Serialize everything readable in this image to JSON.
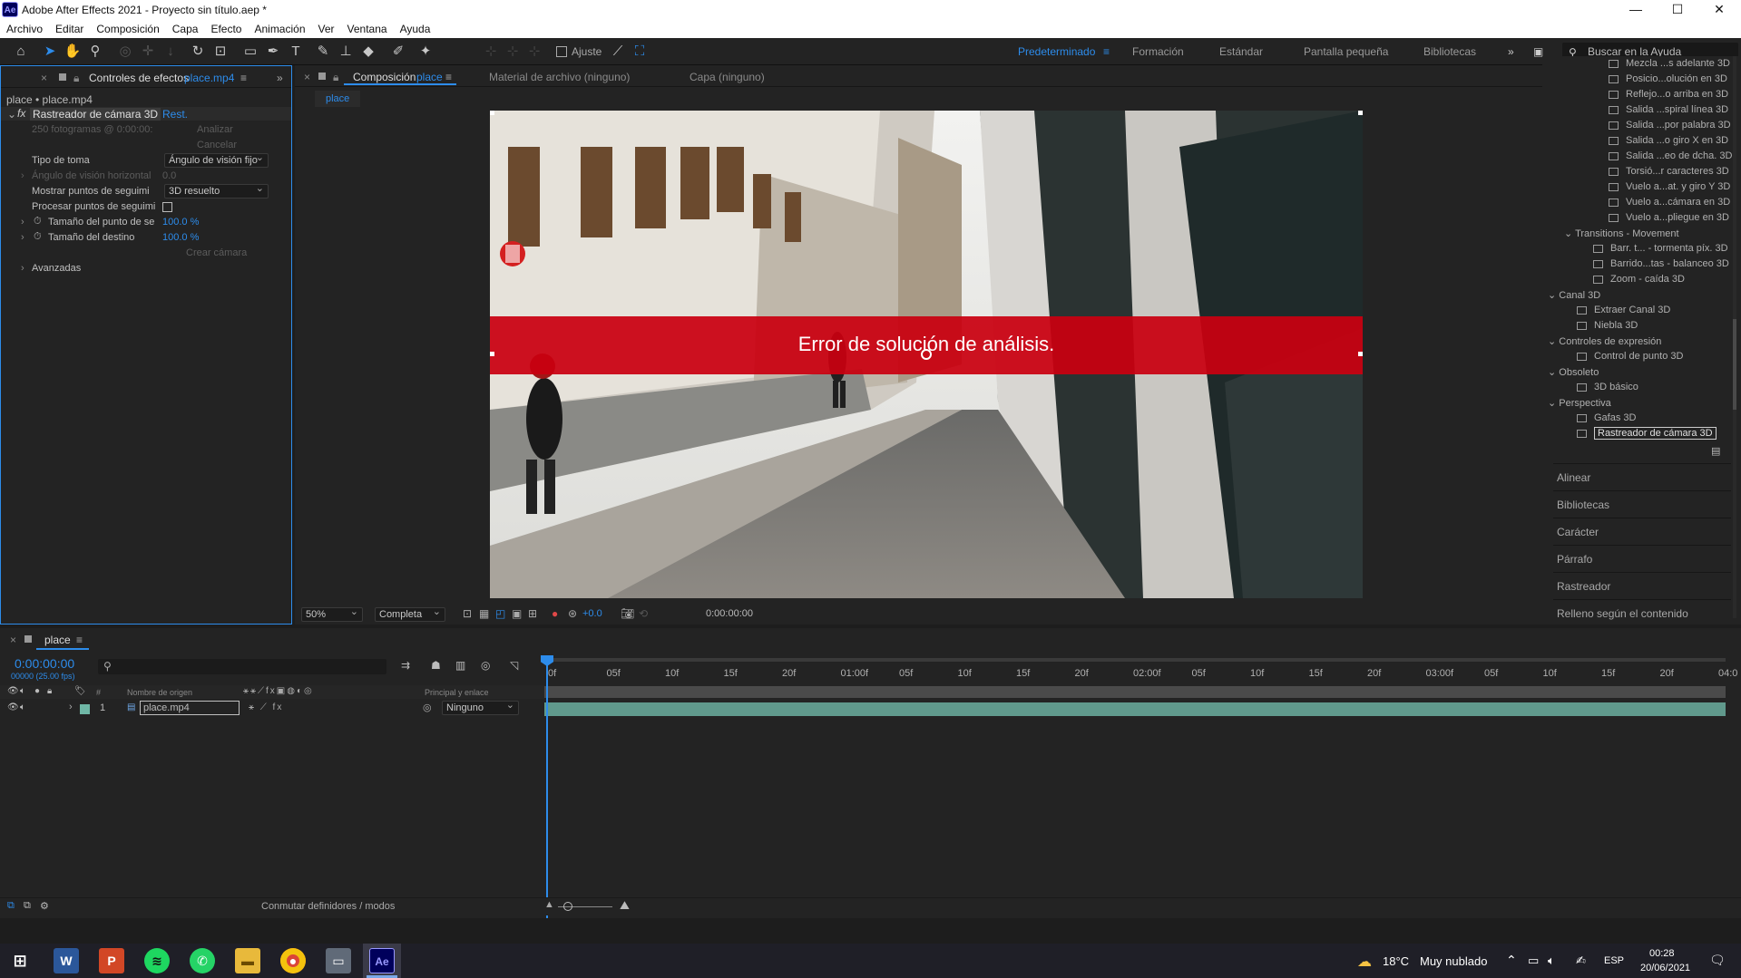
{
  "window": {
    "title": "Adobe After Effects 2021 - Proyecto sin título.aep *",
    "logo": "Ae",
    "min": "—",
    "max": "☐",
    "close": "✕"
  },
  "menu": [
    "Archivo",
    "Editar",
    "Composición",
    "Capa",
    "Efecto",
    "Animación",
    "Ver",
    "Ventana",
    "Ayuda"
  ],
  "toolbar": {
    "snap_label": "Ajuste",
    "workspaces": [
      "Predeterminado",
      "Formación",
      "Estándar",
      "Pantalla pequeña",
      "Bibliotecas"
    ],
    "active_workspace": "Predeterminado",
    "search_placeholder": "Buscar en la Ayuda"
  },
  "effects_panel": {
    "tab_label": "Controles de efectos",
    "tab_file": "place.mp4",
    "breadcrumb": "place • place.mp4",
    "effect_name": "Rastreador de cámara 3D",
    "reset": "Rest.",
    "frames_info": "250 fotogramas @ 0:00:00:",
    "analyze": "Analizar",
    "cancel": "Cancelar",
    "shot_type_label": "Tipo de toma",
    "shot_type_value": "Ángulo de visión fijo",
    "hfov_label": "Ángulo de visión horizontal",
    "hfov_value": "0.0",
    "show_points_label": "Mostrar puntos de seguimi",
    "show_points_value": "3D resuelto",
    "render_points_label": "Procesar puntos de seguimi",
    "point_size_label": "Tamaño del punto de se",
    "point_size_value": "100.0 %",
    "target_size_label": "Tamaño del destino",
    "target_size_value": "100.0 %",
    "create_camera": "Crear cámara",
    "advanced": "Avanzadas"
  },
  "comp_panel": {
    "tab_label": "Composición",
    "tab_comp": "place",
    "footage_tab": "Material de archivo (ninguno)",
    "layer_tab": "Capa (ninguno)",
    "subtab": "place",
    "error_text": "Error de solución de análisis.",
    "zoom": "50%",
    "resolution": "Completa",
    "exposure": "+0.0",
    "timecode": "0:00:00:00"
  },
  "effects_list": {
    "items_top": [
      "Mezcla ...s adelante 3D",
      "Posicio...olución en 3D",
      "Reflejo...o arriba en 3D",
      "Salida ...spiral línea 3D",
      "Salida ...por palabra 3D",
      "Salida ...o giro X en 3D",
      "Salida ...eo de dcha. 3D",
      "Torsió...r caracteres 3D",
      "Vuelo a...at. y giro Y 3D",
      "Vuelo a...cámara en 3D",
      "Vuelo a...pliegue en 3D"
    ],
    "transitions_group": "Transitions - Movement",
    "transitions_items": [
      "Barr. t... - tormenta píx. 3D",
      "Barrido...tas - balanceo 3D",
      "Zoom - caída 3D"
    ],
    "canal_group": "Canal 3D",
    "canal_items": [
      "Extraer Canal 3D",
      "Niebla 3D"
    ],
    "expr_group": "Controles de expresión",
    "expr_items": [
      "Control de punto 3D"
    ],
    "obsoleto_group": "Obsoleto",
    "obsoleto_items": [
      "3D básico"
    ],
    "persp_group": "Perspectiva",
    "persp_items": [
      "Gafas 3D",
      "Rastreador de cámara 3D"
    ],
    "sections": [
      "Alinear",
      "Bibliotecas",
      "Carácter",
      "Párrafo",
      "Rastreador",
      "Relleno según el contenido"
    ]
  },
  "timeline": {
    "tab_label": "place",
    "timecode": "0:00:00:00",
    "fps": "00000 (25.00 fps)",
    "col_source": "Nombre de origen",
    "col_parent": "Principal y enlace",
    "col_num": "#",
    "layer_num": "1",
    "layer_name": "place.mp4",
    "layer_parent": "Ninguno",
    "toggle_label": "Conmutar definidores / modos",
    "ruler": [
      "0f",
      "05f",
      "10f",
      "15f",
      "20f",
      "01:00f",
      "05f",
      "10f",
      "15f",
      "20f",
      "02:00f",
      "05f",
      "10f",
      "15f",
      "20f",
      "03:00f",
      "05f",
      "10f",
      "15f",
      "20f",
      "04:0"
    ]
  },
  "taskbar": {
    "weather_temp": "18°C",
    "weather_desc": "Muy nublado",
    "lang": "ESP",
    "time": "00:28",
    "date": "20/06/2021",
    "ae": "Ae"
  },
  "colors": {
    "accent": "#2d8ceb",
    "error_bar": "#c90010",
    "layer_bar": "#6fb7a6",
    "panel": "#232323"
  }
}
